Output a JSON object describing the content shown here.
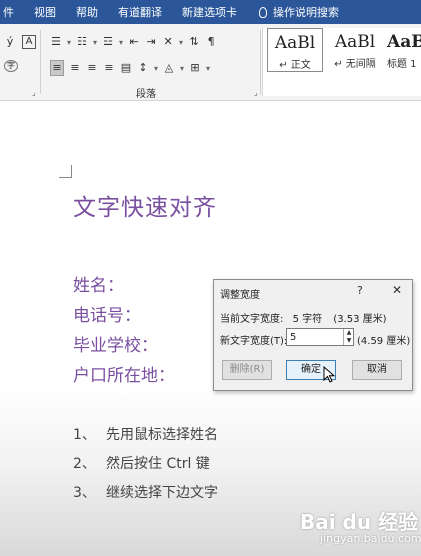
{
  "menubar": {
    "items": [
      "件",
      "视图",
      "帮助",
      "有道翻译",
      "新建选项卡"
    ],
    "tell_me": "操作说明搜索"
  },
  "ribbon": {
    "font_fragment": "ý",
    "bold_a_icon": "A",
    "paragraph_group_label": "段落",
    "styles": [
      {
        "preview": "AaBl",
        "label": "↵ 正文"
      },
      {
        "preview": "AaBl",
        "label": "↵ 无间隔"
      },
      {
        "preview": "AaBb",
        "label": "标题 1"
      }
    ]
  },
  "document": {
    "title": "文字快速对齐",
    "fields": [
      "姓名：",
      "电话号：",
      "毕业学校：",
      "户口所在地："
    ],
    "steps": [
      {
        "num": "1、",
        "text": "先用鼠标选择姓名"
      },
      {
        "num": "2、",
        "text": "然后按住 Ctrl 键"
      },
      {
        "num": "3、",
        "text": "继续选择下边文字"
      }
    ]
  },
  "dialog": {
    "title": "调整宽度",
    "help": "?",
    "close": "✕",
    "current_label": "当前文字宽度:",
    "current_value": "5 字符",
    "current_cm": "(3.53 厘米)",
    "new_label": "新文字宽度(T):",
    "new_value": "5",
    "new_cm": "(4.59 厘米)",
    "delete_label": "删除(R)",
    "ok_label": "确定",
    "cancel_label": "取消"
  },
  "watermark": {
    "brand": "Bai du 经验",
    "url": "jingyan.baidu.com"
  }
}
